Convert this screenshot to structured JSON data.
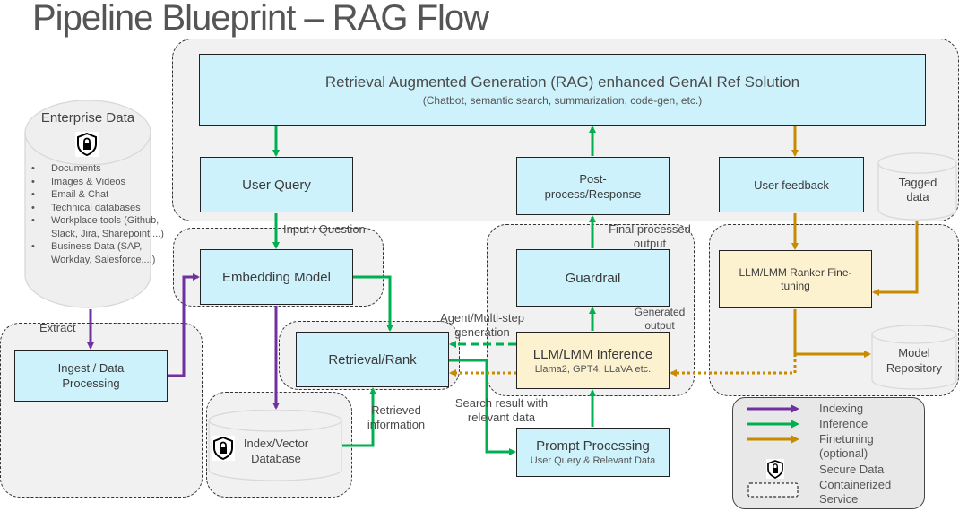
{
  "title": "Pipeline Blueprint – RAG Flow",
  "colors": {
    "indexing": "#7030a0",
    "inference": "#00b050",
    "finetuning": "#c88a00",
    "box_blue": "#cdf2fc",
    "box_yellow": "#fdf2d0",
    "container": "#f1f1f1"
  },
  "rag_solution": {
    "title": "Retrieval Augmented Generation (RAG) enhanced GenAI Ref Solution",
    "subtitle": "(Chatbot, semantic search, summarization, code-gen, etc.)"
  },
  "enterprise_data": {
    "title": "Enterprise Data",
    "icon": "shield-lock-icon",
    "items": [
      "Documents",
      "Images & Videos",
      "Email & Chat",
      "Technical databases",
      "Workplace tools (Github, Slack, Jira, Sharepoint,...)",
      "Business Data (SAP, Workday, Salesforce,...)"
    ]
  },
  "nodes": {
    "user_query": "User Query",
    "post_process": "Post-process/Response",
    "user_feedback": "User feedback",
    "tagged_data": "Tagged data",
    "embedding_model": "Embedding Model",
    "guardrail": "Guardrail",
    "ranker_finetuning": "LLM/LMM Ranker Fine-tuning",
    "ingest": "Ingest / Data Processing",
    "retrieval_rank": "Retrieval/Rank",
    "llm_inference": "LLM/LMM Inference",
    "llm_inference_sub": "Llama2, GPT4, LLaVA etc.",
    "model_repository": "Model Repository",
    "index_db": "Index/Vector Database",
    "prompt_processing": "Prompt Processing",
    "prompt_processing_sub": "User Query & Relevant Data"
  },
  "edge_labels": {
    "extract": "Extract",
    "input_question": "Input / Question",
    "final_output": "Final processed output",
    "generated_output": "Generated output",
    "agent_multistep": "Agent/Multi-step generation",
    "search_result": "Search result with relevant data",
    "retrieved_info": "Retrieved information"
  },
  "legend": {
    "items": [
      {
        "label": "Indexing",
        "type": "arrow",
        "color": "#7030a0"
      },
      {
        "label": "Inference",
        "type": "arrow",
        "color": "#00b050"
      },
      {
        "label": "Finetuning (optional)",
        "type": "arrow",
        "color": "#c88a00"
      },
      {
        "label": "Secure Data",
        "type": "icon",
        "icon": "shield-lock-icon"
      },
      {
        "label": "Containerized Service",
        "type": "dashed-box"
      }
    ]
  }
}
